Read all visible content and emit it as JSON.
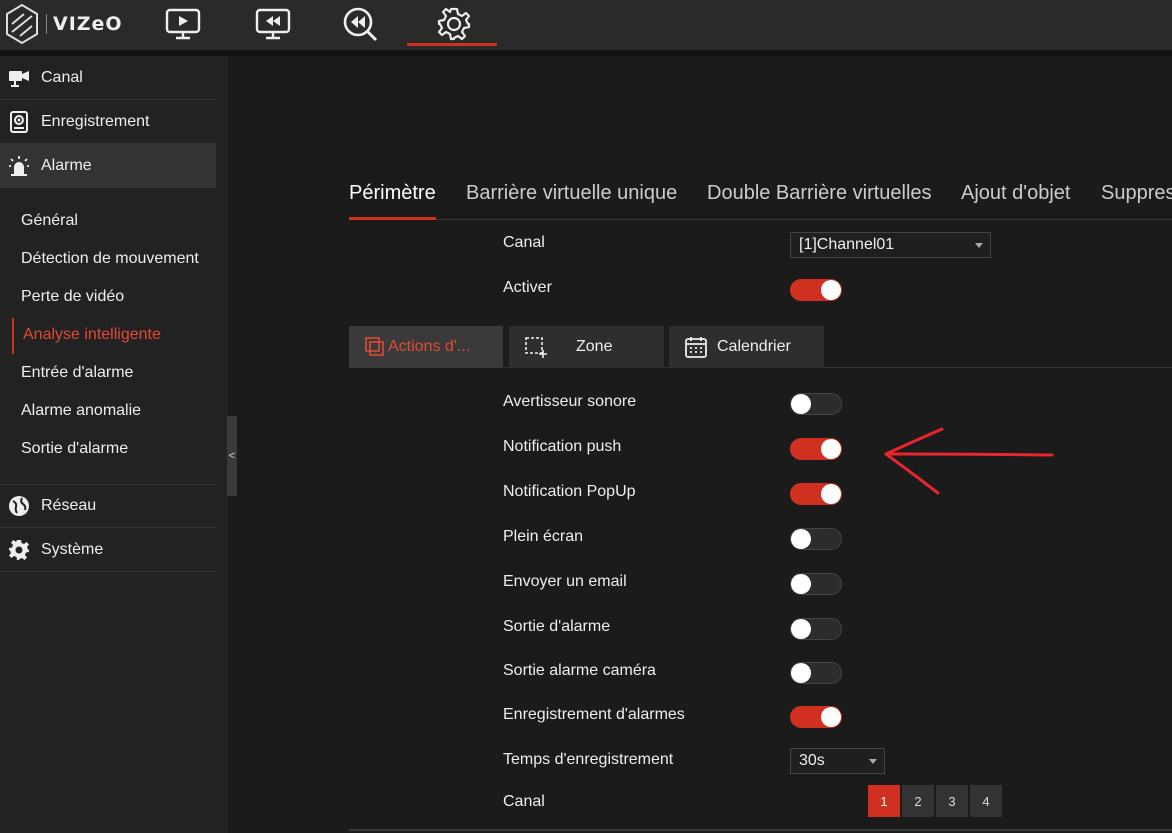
{
  "brand": {
    "name": "VIZeO"
  },
  "colors": {
    "accent": "#d0301f",
    "accent_text": "#e04a35",
    "annotation": "#e8262d"
  },
  "topnav": [
    {
      "name": "live-view",
      "icon": "play-monitor-icon"
    },
    {
      "name": "playback",
      "icon": "rewind-monitor-icon"
    },
    {
      "name": "search",
      "icon": "rewind-search-icon"
    },
    {
      "name": "settings",
      "icon": "gear-icon",
      "active": true
    }
  ],
  "sidebar": {
    "items": [
      {
        "label": "Canal",
        "icon": "camera-icon"
      },
      {
        "label": "Enregistrement",
        "icon": "recorder-icon"
      },
      {
        "label": "Alarme",
        "icon": "alarm-light-icon",
        "active": true
      },
      {
        "label": "Réseau",
        "icon": "globe-icon"
      },
      {
        "label": "Système",
        "icon": "gear-icon"
      }
    ],
    "subitems": [
      {
        "label": "Général"
      },
      {
        "label": "Détection de mouvement"
      },
      {
        "label": "Perte de vidéo"
      },
      {
        "label": "Analyse intelligente",
        "current": true
      },
      {
        "label": "Entrée d'alarme"
      },
      {
        "label": "Alarme anomalie"
      },
      {
        "label": "Sortie d'alarme"
      }
    ],
    "collapse_label": "<"
  },
  "tabs": [
    {
      "label": "Périmètre",
      "active": true
    },
    {
      "label": "Barrière virtuelle unique"
    },
    {
      "label": "Double Barrière virtuelles"
    },
    {
      "label": "Ajout d'objet"
    },
    {
      "label": "Suppres"
    }
  ],
  "top_form": {
    "canal_label": "Canal",
    "canal_value": "[1]Channel01",
    "activer_label": "Activer",
    "activer_on": true
  },
  "subtabs": [
    {
      "label": "Actions d'...",
      "icon": "layers-icon",
      "active": true
    },
    {
      "label": "Zone",
      "icon": "zone-select-icon"
    },
    {
      "label": "Calendrier",
      "icon": "calendar-icon"
    }
  ],
  "actions": [
    {
      "label": "Avertisseur sonore",
      "on": false
    },
    {
      "label": "Notification push",
      "on": true
    },
    {
      "label": "Notification PopUp",
      "on": true
    },
    {
      "label": "Plein écran",
      "on": false
    },
    {
      "label": "Envoyer un email",
      "on": false
    },
    {
      "label": "Sortie d'alarme",
      "on": false
    },
    {
      "label": "Sortie alarme caméra",
      "on": false
    },
    {
      "label": "Enregistrement d'alarmes",
      "on": true
    }
  ],
  "record_time": {
    "label": "Temps d'enregistrement",
    "value": "30s"
  },
  "channel_select": {
    "label": "Canal",
    "pages": [
      "1",
      "2",
      "3",
      "4"
    ],
    "active": "1"
  }
}
